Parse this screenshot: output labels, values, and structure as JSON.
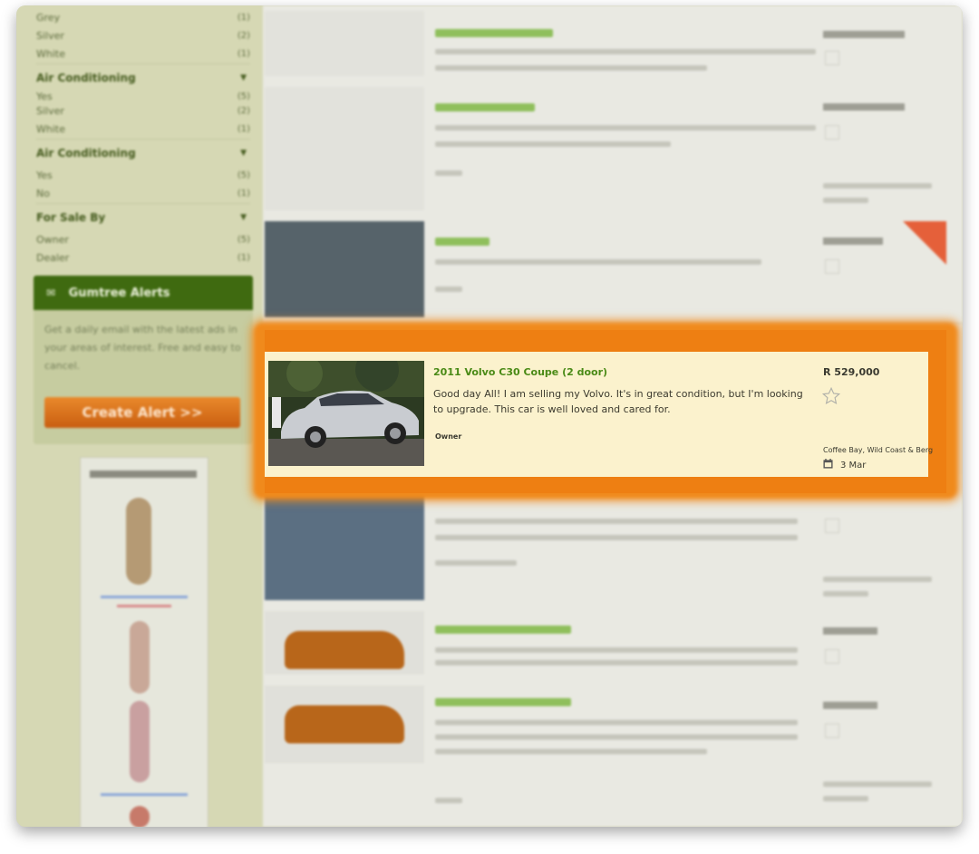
{
  "sidebar": {
    "filters_top": [
      {
        "label": "Grey",
        "count": "(1)"
      },
      {
        "label": "Silver",
        "count": "(2)"
      },
      {
        "label": "White",
        "count": "(1)"
      }
    ],
    "group_air_1": {
      "title": "Air Conditioning"
    },
    "filters_mid": [
      {
        "label": "Yes",
        "count": "(5)"
      },
      {
        "label": "Silver",
        "count": "(2)"
      },
      {
        "label": "White",
        "count": "(1)"
      }
    ],
    "group_air_2": {
      "title": "Air Conditioning"
    },
    "filters_air": [
      {
        "label": "Yes",
        "count": "(5)"
      },
      {
        "label": "No",
        "count": "(1)"
      }
    ],
    "group_sale": {
      "title": "For Sale By"
    },
    "filters_sale": [
      {
        "label": "Owner",
        "count": "(5)"
      },
      {
        "label": "Dealer",
        "count": "(1)"
      }
    ],
    "alerts": {
      "title": "Gumtree Alerts",
      "text": "Get a daily email with the latest ads in your areas of interest. Free and easy to cancel.",
      "button": "Create Alert >>"
    }
  },
  "featured": {
    "title": "2011 Volvo C30 Coupe (2 door)",
    "description": "Good day All! I am selling my Volvo. It's in great condition, but I'm looking to upgrade. This car is well loved and cared for.",
    "seller": "Owner",
    "price": "R 529,000",
    "location": "Coffee Bay, Wild Coast & Berg",
    "date": "3 Mar"
  },
  "colors": {
    "highlight": "#f08a1c",
    "title_green": "#4a8a16",
    "alerts_green": "#3f6a10",
    "button_orange": "#e07d22"
  }
}
